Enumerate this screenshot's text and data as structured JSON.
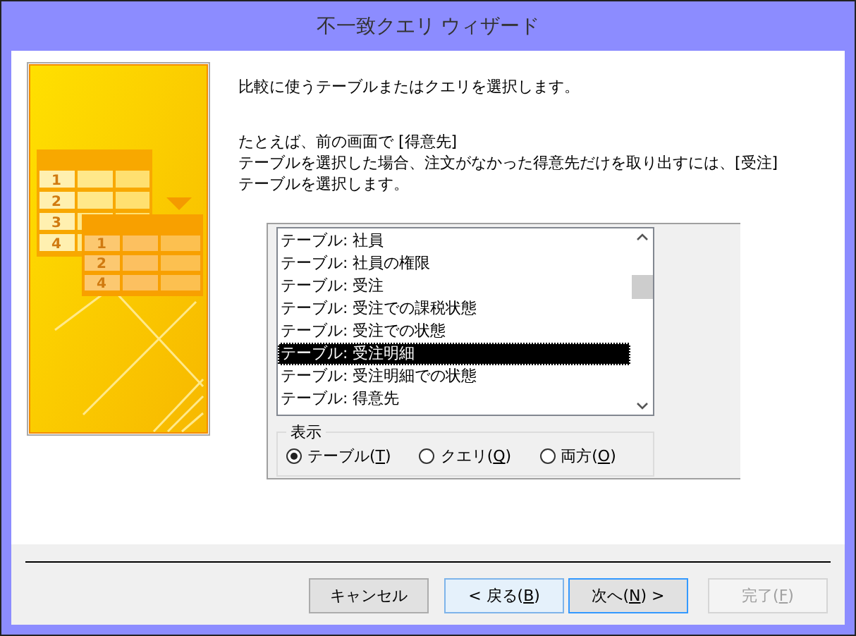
{
  "window": {
    "title": "不一致クエリ ウィザード"
  },
  "illustration": {
    "upper_table_rows": [
      "1",
      "2",
      "3",
      "4"
    ],
    "lower_table_rows": [
      "1",
      "2",
      "4"
    ]
  },
  "intro": "比較に使うテーブルまたはクエリを選択します。",
  "example": [
    "たとえば、前の画面で [得意先]",
    "テーブルを選択した場合、注文がなかった得意先だけを取り出すには、[受注]",
    "テーブルを選択します。"
  ],
  "list": {
    "items": [
      {
        "label": "テーブル: 社員",
        "selected": false
      },
      {
        "label": "テーブル: 社員の権限",
        "selected": false
      },
      {
        "label": "テーブル: 受注",
        "selected": false
      },
      {
        "label": "テーブル: 受注での課税状態",
        "selected": false
      },
      {
        "label": "テーブル: 受注での状態",
        "selected": false
      },
      {
        "label": "テーブル: 受注明細",
        "selected": true
      },
      {
        "label": "テーブル: 受注明細での状態",
        "selected": false
      },
      {
        "label": "テーブル: 得意先",
        "selected": false
      }
    ]
  },
  "view_group": {
    "title": "表示",
    "options": [
      {
        "label": "テーブル(",
        "key": "T",
        "tail": ")",
        "selected": true
      },
      {
        "label": "クエリ(",
        "key": "Q",
        "tail": ")",
        "selected": false
      },
      {
        "label": "両方(",
        "key": "O",
        "tail": ")",
        "selected": false
      }
    ]
  },
  "buttons": [
    {
      "label": "キャンセル",
      "hovered": false,
      "default": false,
      "disabled": false
    },
    {
      "label": "< 戻る(",
      "key": "B",
      "tail": ")",
      "hovered": true,
      "default": false,
      "disabled": false
    },
    {
      "label": "次へ(",
      "key": "N",
      "tail": ") >",
      "hovered": false,
      "default": true,
      "disabled": false
    },
    {
      "label": "完了(",
      "key": "F",
      "tail": ")",
      "hovered": false,
      "default": false,
      "disabled": true
    }
  ]
}
